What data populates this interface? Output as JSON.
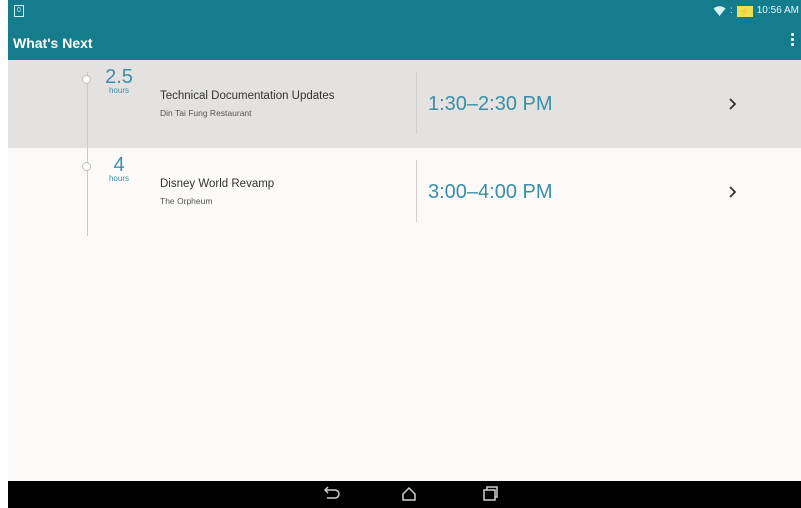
{
  "status_bar": {
    "sim_icon": "sim-card-icon",
    "clock": "10:56 AM",
    "signal_glyph": ":"
  },
  "app_bar": {
    "title": "What's Next",
    "menu_icon": "overflow-menu-icon"
  },
  "events": [
    {
      "duration_value": "2.5",
      "duration_unit": "hours",
      "title": "Technical Documentation Updates",
      "location": "Din Tai Fung Restaurant",
      "time": "1:30–2:30 PM"
    },
    {
      "duration_value": "4",
      "duration_unit": "hours",
      "title": "Disney World Revamp",
      "location": "The Orpheum",
      "time": "3:00–4:00 PM"
    }
  ],
  "nav_bar": {
    "back_icon": "back-icon",
    "home_icon": "home-icon",
    "recents_icon": "recent-apps-icon"
  },
  "colors": {
    "accent": "#147c8c",
    "time_text": "#3a8fa6",
    "row_highlight": "#e3e2e1"
  }
}
